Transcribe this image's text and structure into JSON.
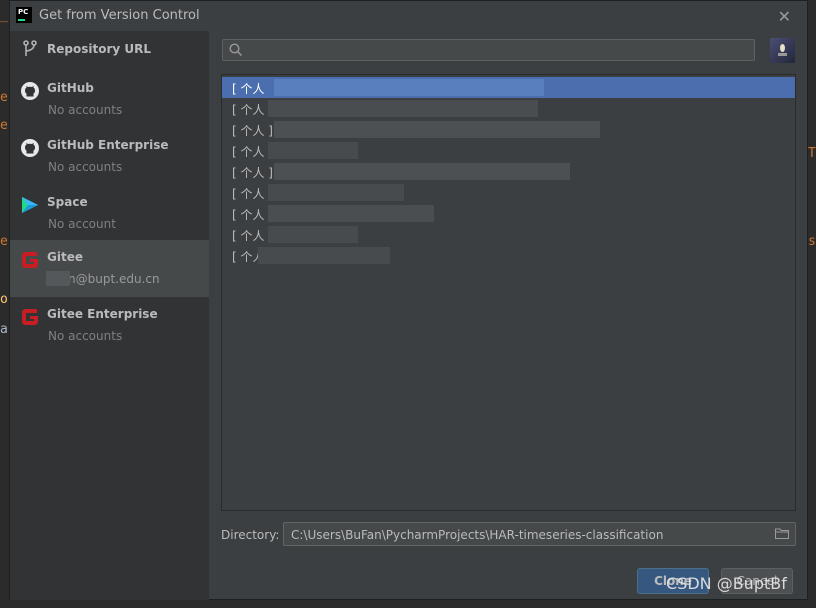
{
  "window": {
    "title": "Get from Version Control",
    "app_icon_text": "PC"
  },
  "sidebar": {
    "items": [
      {
        "name": "Repository URL",
        "sub": "",
        "icon": "branch-icon"
      },
      {
        "name": "GitHub",
        "sub": "No accounts",
        "icon": "github-icon"
      },
      {
        "name": "GitHub Enterprise",
        "sub": "No accounts",
        "icon": "github-icon"
      },
      {
        "name": "Space",
        "sub": "No account",
        "icon": "space-icon"
      },
      {
        "name": "Gitee",
        "sub": "n@bupt.edu.cn",
        "icon": "gitee-icon",
        "selected": true
      },
      {
        "name": "Gitee Enterprise",
        "sub": "No accounts",
        "icon": "gitee-icon"
      }
    ]
  },
  "search": {
    "placeholder": "",
    "value": ""
  },
  "repositories": [
    {
      "label": "[ 个人",
      "selected": true
    },
    {
      "label": "[ 个人"
    },
    {
      "label": "[ 个人 ]"
    },
    {
      "label": "[ 个人"
    },
    {
      "label": "[ 个人 ]"
    },
    {
      "label": "[ 个人"
    },
    {
      "label": "[ 个人"
    },
    {
      "label": "[ 个人"
    },
    {
      "label": "[ 个人"
    }
  ],
  "directory": {
    "label": "Directory:",
    "value": "C:\\Users\\BuFan\\PycharmProjects\\HAR-timeseries-classification"
  },
  "buttons": {
    "clone": "Clone",
    "cancel": "Cancel"
  },
  "watermark": "CSDN @BuptBf",
  "colors": {
    "selection": "#4b6eaf",
    "clone_button": "#365880",
    "gitee_red": "#c71d23"
  }
}
